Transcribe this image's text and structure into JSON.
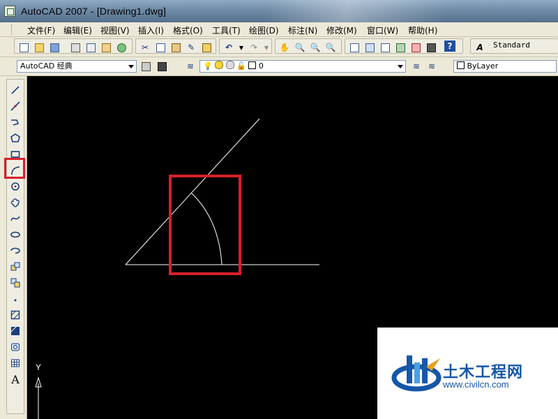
{
  "window": {
    "title": "AutoCAD 2007 - [Drawing1.dwg]"
  },
  "menu": {
    "items": [
      "文件(F)",
      "编辑(E)",
      "视图(V)",
      "插入(I)",
      "格式(O)",
      "工具(T)",
      "绘图(D)",
      "标注(N)",
      "修改(M)",
      "窗口(W)",
      "帮助(H)"
    ]
  },
  "toolbar": {
    "text_style": "Standard",
    "workspace": "AutoCAD 经典",
    "layer_name": "0",
    "color_value": "ByLayer"
  },
  "draw_toolbar": {
    "tools": [
      "line-icon",
      "construction-line-icon",
      "polyline-icon",
      "polygon-icon",
      "rectangle-icon",
      "arc-icon",
      "circle-icon",
      "revision-cloud-icon",
      "spline-icon",
      "ellipse-icon",
      "ellipse-arc-icon",
      "insert-block-icon",
      "make-block-icon",
      "point-icon",
      "hatch-icon",
      "gradient-icon",
      "region-icon",
      "table-icon",
      "multiline-text-icon"
    ],
    "text_tool_label": "A",
    "highlighted_tool": "arc-icon"
  },
  "canvas": {
    "ucs_label": "Y",
    "annotation_color": "#d6202c",
    "background": "#000000",
    "line_color": "#ffffff"
  },
  "watermark": {
    "title": "土木工程网",
    "url": "www.civilcn.com"
  }
}
